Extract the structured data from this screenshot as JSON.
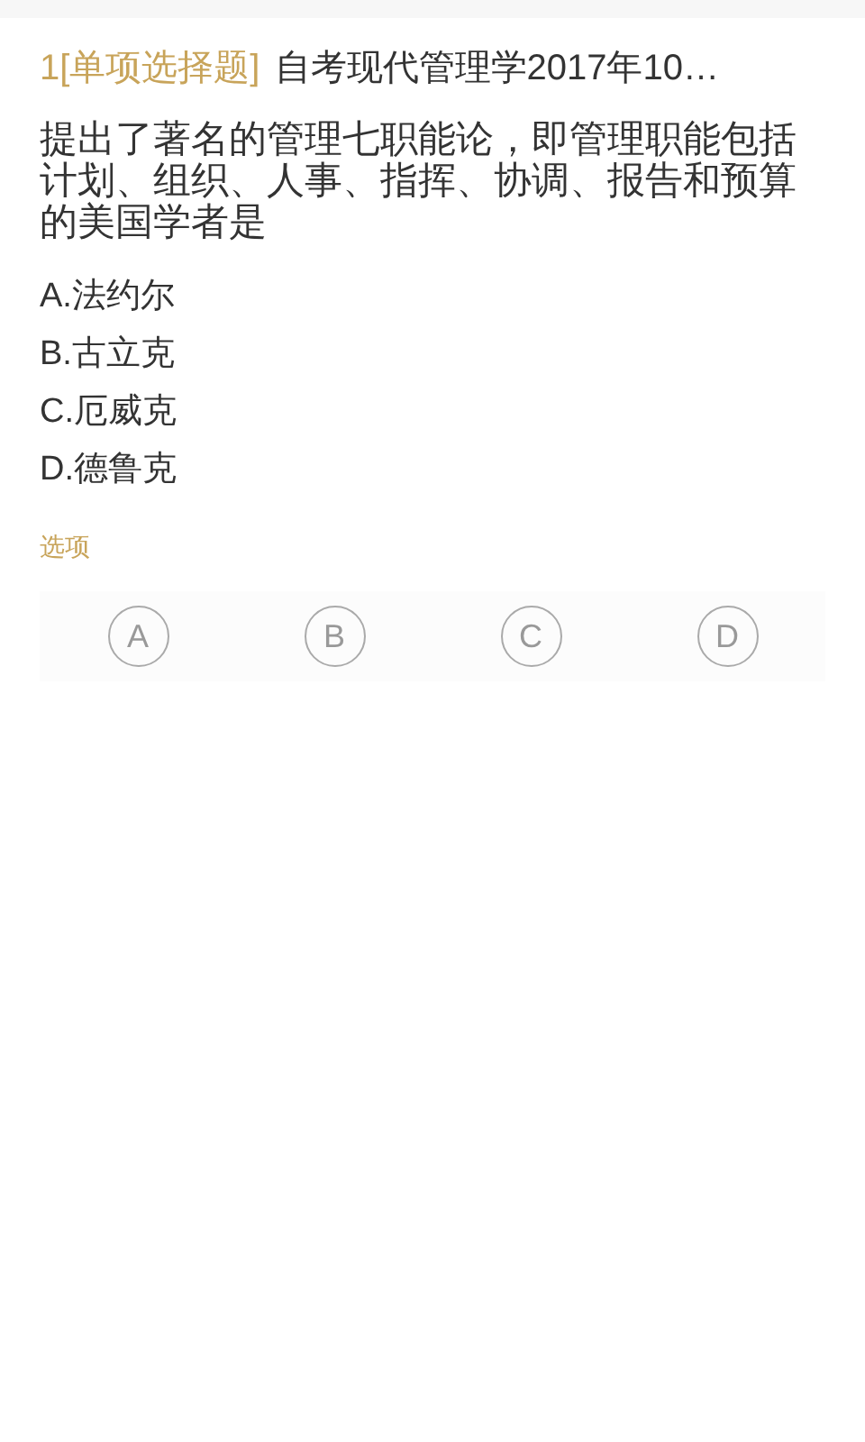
{
  "header": {
    "number": "1",
    "type": "[单项选择题]",
    "title": "自考现代管理学2017年10…"
  },
  "question": "提出了著名的管理七职能论，即管理职能包括计划、组织、人事、指挥、协调、报告和预算的美国学者是",
  "options": [
    "A.法约尔",
    "B.古立克",
    "C.厄威克",
    "D.德鲁克"
  ],
  "answer_label": "选项",
  "answers": [
    {
      "label": "A",
      "selected": false
    },
    {
      "label": "B",
      "selected": false
    },
    {
      "label": "C",
      "selected": false
    },
    {
      "label": "D",
      "selected": false
    }
  ]
}
